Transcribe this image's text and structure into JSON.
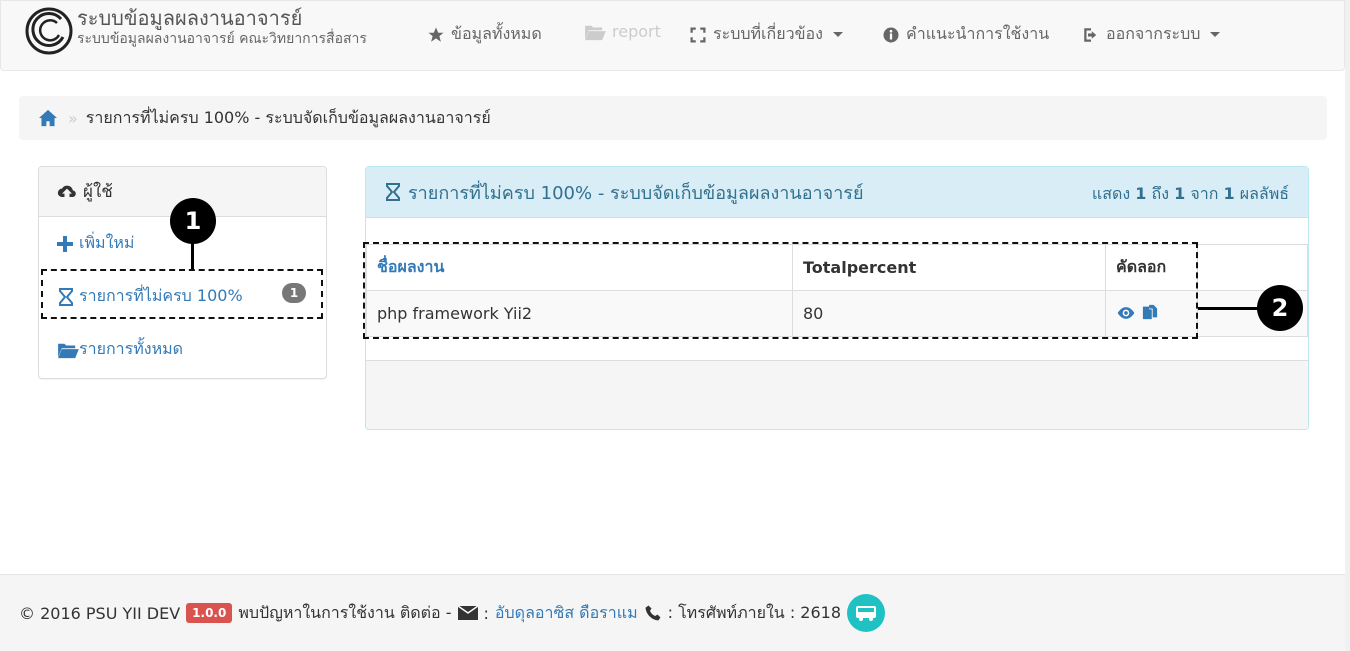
{
  "navbar": {
    "brand_title": "ระบบข้อมูลผลงานอาจารย์",
    "brand_subtitle": "ระบบข้อมูลผลงานอาจารย์ คณะวิทยาการสื่อสาร",
    "items": [
      {
        "label": "ข้อมูลทั้งหมด",
        "icon": "star-icon"
      },
      {
        "label": "report",
        "icon": "folder-open-icon"
      },
      {
        "label": "ระบบที่เกี่ยวข้อง",
        "icon": "fullscreen-icon"
      },
      {
        "label": "คำแนะนำการใช้งาน",
        "icon": "info-circle-icon"
      },
      {
        "label": "ออกจากระบบ",
        "icon": "logout-icon"
      }
    ]
  },
  "breadcrumb": {
    "home_icon": "home-icon",
    "separator": "»",
    "current": "รายการที่ไม่ครบ 100% - ระบบจัดเก็บข้อมูลผลงานอาจารย์"
  },
  "sidebar": {
    "title": "ผู้ใช้",
    "items": [
      {
        "label": "เพิ่มใหม่",
        "icon": "plus-icon"
      },
      {
        "label": "รายการที่ไม่ครบ 100%",
        "icon": "hourglass-icon",
        "badge": "1"
      },
      {
        "label": "รายการทั้งหมด",
        "icon": "folder-open-icon"
      }
    ]
  },
  "main": {
    "title": "รายการที่ไม่ครบ 100% - ระบบจัดเก็บข้อมูลผลงานอาจารย์",
    "summary": {
      "prefix": "แสดง",
      "from": "1",
      "to_word": "ถึง",
      "to": "1",
      "of_word": "จาก",
      "total": "1",
      "suffix": "ผลลัพธ์"
    },
    "table": {
      "headers": [
        "ชื่อผลงาน",
        "Totalpercent",
        "คัดลอก"
      ],
      "rows": [
        {
          "name": "php framework Yii2",
          "totalpercent": "80",
          "actions": [
            "eye-icon",
            "copy-icon"
          ]
        }
      ]
    }
  },
  "annotations": {
    "callout1": "1",
    "callout2": "2"
  },
  "footer": {
    "copyright": "© 2016 PSU YII DEV",
    "version": "1.0.0",
    "problem_text": "พบปัญหาในการใช้งาน ติดต่อ -",
    "colon1": ":",
    "contact_name": "อับดุลอาซิส ดือราแม",
    "phone_text": ": โทรศัพท์ภายใน : 2618",
    "colors": {
      "version_badge": "#d9534f",
      "link": "#337ab7",
      "bus_icon_bg": "#1fc1c3"
    }
  }
}
